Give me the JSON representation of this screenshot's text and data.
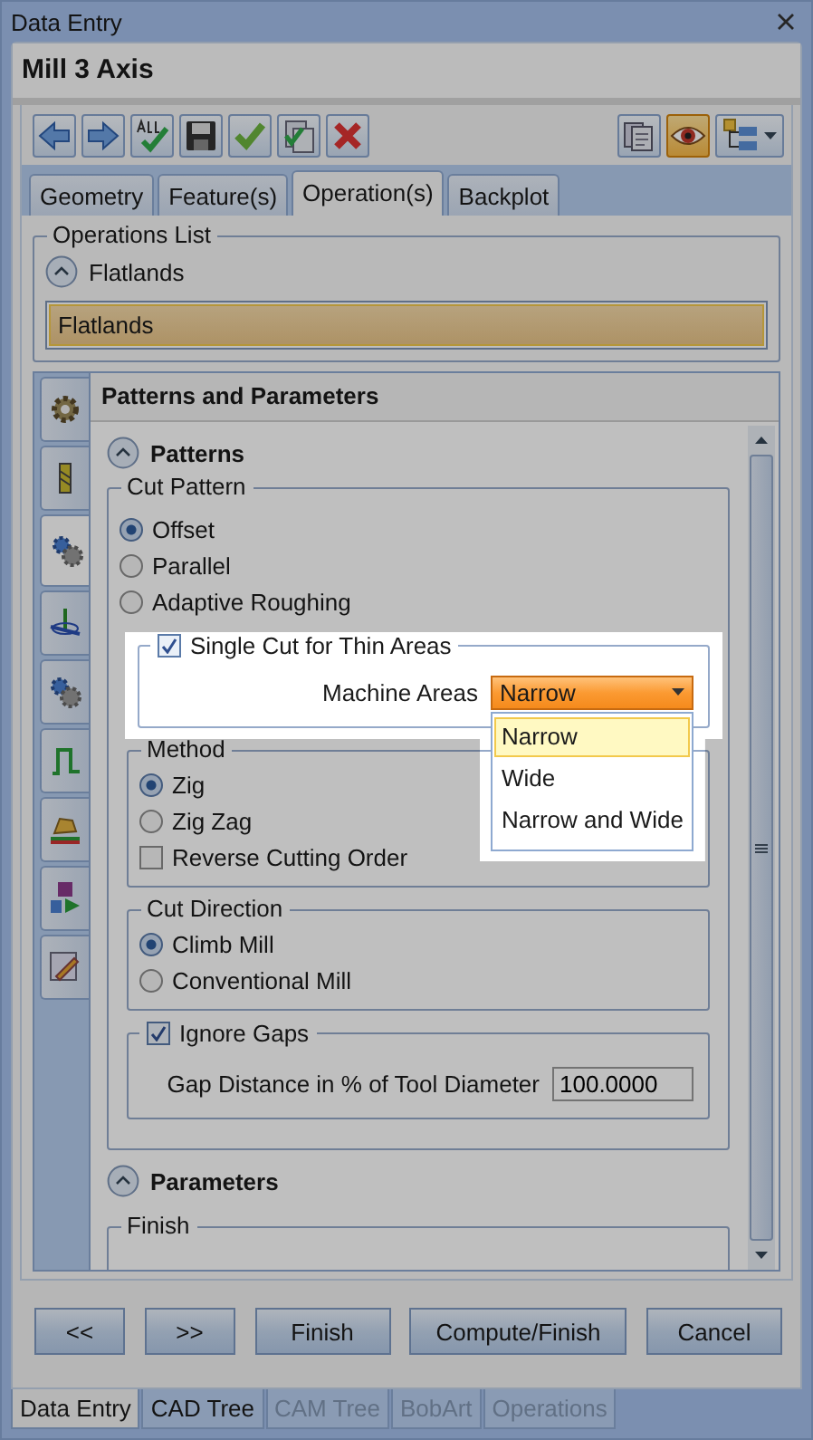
{
  "window": {
    "title": "Data Entry"
  },
  "header": {
    "title": "Mill 3 Axis"
  },
  "toolbar": {
    "left": [
      {
        "kind": "back",
        "selected": false
      },
      {
        "kind": "forward",
        "selected": false
      },
      {
        "kind": "check-all",
        "selected": false
      },
      {
        "kind": "save",
        "selected": false
      },
      {
        "kind": "check",
        "selected": false
      },
      {
        "kind": "sheet-check",
        "selected": false
      },
      {
        "kind": "delete",
        "selected": false
      }
    ],
    "right": [
      {
        "kind": "sheets",
        "selected": false
      },
      {
        "kind": "eye",
        "selected": true
      },
      {
        "kind": "tree-menu",
        "selected": false
      }
    ]
  },
  "tabs": [
    {
      "label": "Geometry",
      "selected": false
    },
    {
      "label": "Feature(s)",
      "selected": false
    },
    {
      "label": "Operation(s)",
      "selected": true
    },
    {
      "label": "Backplot",
      "selected": false
    }
  ],
  "operations_list": {
    "title": "Operations List",
    "expander_label": "Flatlands",
    "items": [
      {
        "label": "Flatlands",
        "selected": true
      }
    ]
  },
  "side_tabs": [
    {
      "kind": "gear",
      "selected": false
    },
    {
      "kind": "tool",
      "selected": false
    },
    {
      "kind": "gears",
      "selected": true
    },
    {
      "kind": "axis",
      "selected": false
    },
    {
      "kind": "gears",
      "selected": false
    },
    {
      "kind": "step",
      "selected": false
    },
    {
      "kind": "shape",
      "selected": false
    },
    {
      "kind": "mill",
      "selected": false
    },
    {
      "kind": "pencil",
      "selected": false
    }
  ],
  "panel": {
    "title": "Patterns and Parameters",
    "patterns": {
      "title": "Patterns"
    },
    "cut_pattern": {
      "title": "Cut Pattern",
      "options": [
        {
          "label": "Offset",
          "selected": true
        },
        {
          "label": "Parallel",
          "selected": false
        },
        {
          "label": "Adaptive Roughing",
          "selected": false
        }
      ]
    },
    "thin_areas": {
      "label": "Single Cut for Thin Areas",
      "checked": true,
      "machine_areas": {
        "label": "Machine Areas",
        "value": "Narrow",
        "expanded": true,
        "options": [
          {
            "label": "Narrow",
            "selected": true
          },
          {
            "label": "Wide",
            "selected": false
          },
          {
            "label": "Narrow and Wide",
            "selected": false
          }
        ]
      }
    },
    "method": {
      "title": "Method",
      "options": [
        {
          "label": "Zig",
          "selected": true
        },
        {
          "label": "Zig Zag",
          "selected": false
        }
      ],
      "reverse": {
        "label": "Reverse Cutting Order",
        "checked": false
      }
    },
    "cut_direction": {
      "title": "Cut Direction",
      "options": [
        {
          "label": "Climb Mill",
          "selected": true
        },
        {
          "label": "Conventional Mill",
          "selected": false
        }
      ]
    },
    "ignore_gaps": {
      "label": "Ignore Gaps",
      "checked": true,
      "gap_distance": {
        "label": "Gap Distance in % of Tool Diameter",
        "value": "100.0000"
      }
    },
    "parameters": {
      "title": "Parameters"
    },
    "finish": {
      "title": "Finish"
    }
  },
  "buttons": [
    "<<",
    ">>",
    "Finish",
    "Compute/Finish",
    "Cancel"
  ],
  "bottom_tabs": [
    {
      "label": "Data Entry",
      "selected": true,
      "disabled": false
    },
    {
      "label": "CAD Tree",
      "selected": false,
      "disabled": false
    },
    {
      "label": "CAM Tree",
      "selected": false,
      "disabled": true
    },
    {
      "label": "BobArt",
      "selected": false,
      "disabled": true
    },
    {
      "label": "Operations",
      "selected": false,
      "disabled": true
    }
  ]
}
